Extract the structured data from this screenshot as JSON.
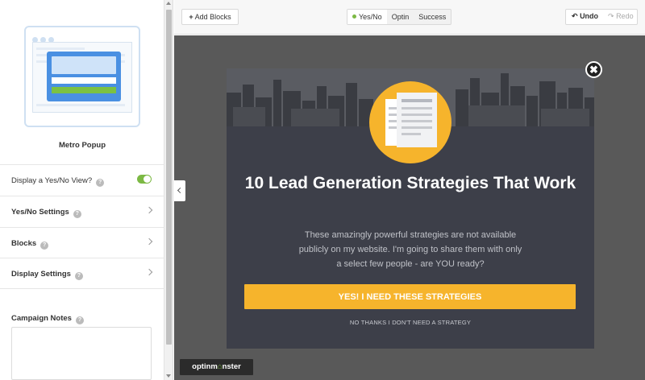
{
  "sidebar": {
    "theme_name": "Metro Popup",
    "rows": [
      {
        "label": "Display a Yes/No View?",
        "type": "toggle",
        "on": true
      },
      {
        "label": "Yes/No Settings",
        "type": "link"
      },
      {
        "label": "Blocks",
        "type": "link"
      },
      {
        "label": "Display Settings",
        "type": "link"
      }
    ],
    "help_glyph": "?",
    "campaign_notes_label": "Campaign Notes",
    "campaign_notes_value": ""
  },
  "toolbar": {
    "add_blocks_icon": "+",
    "add_blocks_label": "Add Blocks",
    "view_tabs": [
      {
        "label": "Yes/No",
        "active": true
      },
      {
        "label": "Optin",
        "active": false
      },
      {
        "label": "Success",
        "active": false
      }
    ],
    "undo_icon": "↶",
    "undo_label": "Undo",
    "redo_icon": "↷",
    "redo_label": "Redo"
  },
  "popup": {
    "close_glyph": "✖",
    "headline": "10 Lead Generation Strategies That Work",
    "body_lines": [
      "These amazingly powerful strategies are not available",
      "publicly on my website. I'm going to share them with only",
      "a select few people - are YOU ready?"
    ],
    "cta_label": "YES! I NEED THESE STRATEGIES",
    "no_thanks_label": "NO THANKS I DON'T NEED A STRATEGY"
  },
  "brand": {
    "part1": "optinm",
    "part2": "⌂",
    "part3": "nster"
  },
  "colors": {
    "accent_yellow": "#f6b42c",
    "toggle_green": "#7cb944",
    "popup_bg": "#3d3f49",
    "canvas_bg": "#595959"
  }
}
